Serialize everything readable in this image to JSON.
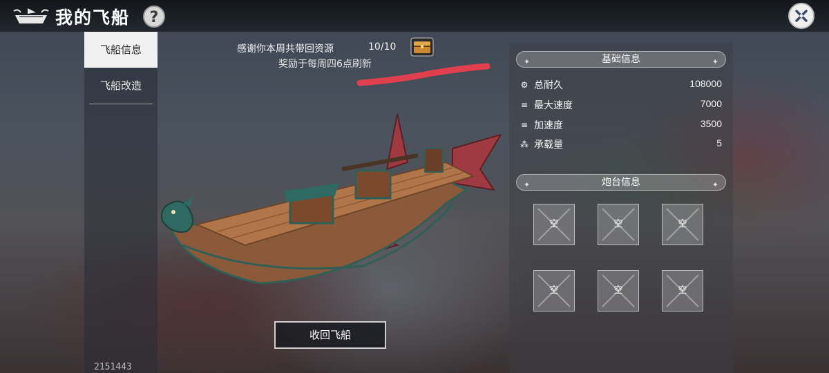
{
  "window": {
    "title": "我的飞船"
  },
  "sidebar": {
    "tabs": [
      {
        "label": "飞船信息",
        "active": true
      },
      {
        "label": "飞船改造",
        "active": false
      }
    ]
  },
  "reward": {
    "text": "感谢你本周共带回资源",
    "count": "10/10",
    "refresh_note": "奖励于每周四6点刷新"
  },
  "actions": {
    "recall_label": "收回飞船"
  },
  "basic_info": {
    "title": "基础信息",
    "stats": [
      {
        "icon": "gear-icon",
        "label": "总耐久",
        "value": "108000"
      },
      {
        "icon": "speed-icon",
        "label": "最大速度",
        "value": "7000"
      },
      {
        "icon": "acceleration-icon",
        "label": "加速度",
        "value": "3500"
      },
      {
        "icon": "capacity-icon",
        "label": "承载量",
        "value": "5"
      }
    ]
  },
  "turret_info": {
    "title": "炮台信息",
    "slots": [
      "空",
      "空",
      "空",
      "空",
      "空",
      "空"
    ]
  },
  "footer": {
    "build_id": "2151443"
  },
  "colors": {
    "active_tab_bg": "#f1f1f1",
    "scribble": "#e0404e",
    "chest": "#d49a3a"
  }
}
